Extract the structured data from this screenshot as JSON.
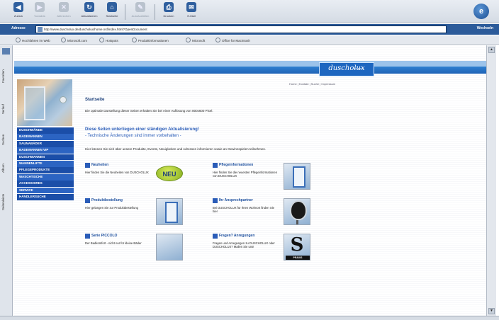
{
  "browser": {
    "toolbar": [
      {
        "label": "Zurück",
        "glyph": "◀",
        "enabled": true
      },
      {
        "label": "Vorwärts",
        "glyph": "▶",
        "enabled": false
      },
      {
        "label": "Abbrechen",
        "glyph": "✕",
        "enabled": false
      },
      {
        "label": "Aktualisieren",
        "glyph": "↻",
        "enabled": true
      },
      {
        "label": "Startseite",
        "glyph": "⌂",
        "enabled": true
      },
      {
        "label": "AutoAusfüllen",
        "glyph": "✎",
        "enabled": false
      },
      {
        "label": "Drucken",
        "glyph": "⎙",
        "enabled": true
      },
      {
        "label": "E-Mail",
        "glyph": "✉",
        "enabled": true
      }
    ],
    "brand_glyph": "e",
    "address_label": "Adresse",
    "url": "http://www.duscholux.de/duscholux/home.nsf/index.html?OpenDocument",
    "go_label": "Wechseln",
    "links": [
      "Hochfahren im Web",
      "Microsoft.com",
      "Hotspots",
      "Produktinformationen",
      "Microsoft",
      "Office für Macintosh"
    ],
    "explorer_tabs": [
      "Favoriten",
      "Verlauf",
      "Suchen",
      "Album",
      "Seitenleiste"
    ]
  },
  "site": {
    "logo_text": "duscholux",
    "logo_tag": "SCHWEIZ",
    "top_nav": "Home | Kontakt | Suche | Impressum",
    "nav": [
      "DUSCHWÄNDE",
      "BADEWANNEN",
      "SAUNABÄDER",
      "BADEWANNEN VIP",
      "DUSCHWANNEN",
      "WANNENLIFTE",
      "PFLEGEPRODUKTE",
      "WASCHTISCHE",
      "ACCESSOIRES",
      "SERVICE",
      "HÄNDLERSUCHE"
    ],
    "start_heading": "Startseite",
    "intro": "Die optimale Darstellung dieser Seiten erhalten Sie bei einer Auflösung von 800x600 Pixel.",
    "update_heading": "Diese Seiten unterliegen einer ständigen Aktualisierung!",
    "update_sub": "- Technische Änderungen sind immer vorbehalten -",
    "info_text": "Hier können Sie sich über unsere Produkte, Events, Neuigkeiten und Adressen informieren sowie an Gewinnspielen teilnehmen.",
    "neu_badge": "NEU",
    "tiles": [
      {
        "title": "Neuheiten",
        "text": "Hier finden Sie die Neuheiten von DUSCHOLUX"
      },
      {
        "title": "Pflegeinformationen",
        "text": "Hier finden Sie die neuesten Pflegeinformationen von DUSCHOLUX"
      },
      {
        "title": "Produktbestellung",
        "text": "Hier gelangen Sie zur Produktbestellung"
      },
      {
        "title": "Ihr Ansprechpartner",
        "text": "Bei DUSCHOLUX für Ihren Wohnort finden Sie hier"
      },
      {
        "title": "Serie PICCOLO",
        "text": "Der Badkomfort - nicht nur für kleine Bäder"
      },
      {
        "title": "Fragen? Anregungen",
        "text": "Fragen und Anregungen zu DUSCHOLUX oder DUSCHOLUX? Mailen Sie uns!"
      }
    ],
    "s_logo": "S",
    "s_logo_tag": "PRAXIS"
  }
}
